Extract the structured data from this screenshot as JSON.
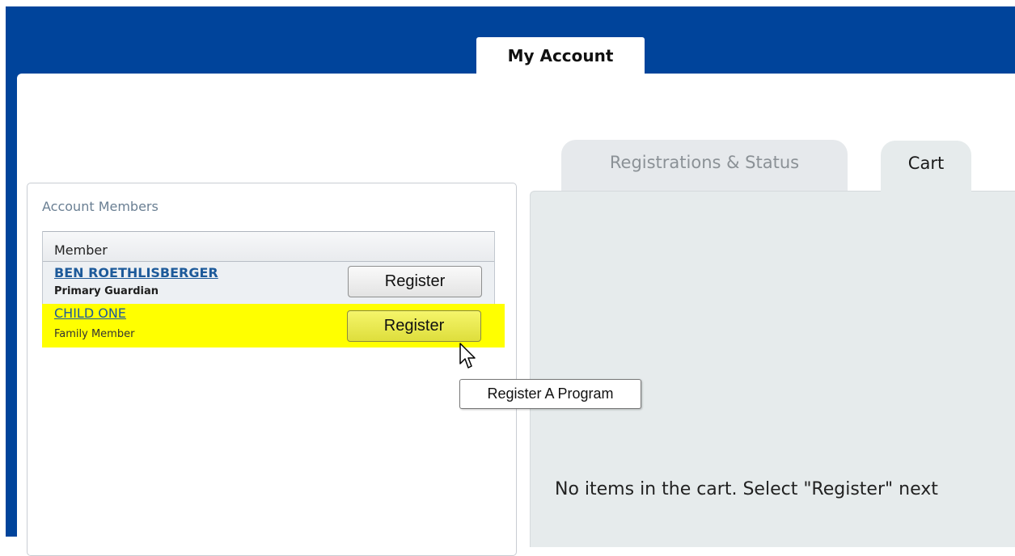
{
  "header": {
    "tab_my_account": "My Account"
  },
  "members": {
    "title": "Account Members",
    "column_header": "Member",
    "rows": [
      {
        "name": "BEN ROETHLISBERGER",
        "role": "Primary Guardian",
        "button": "Register"
      },
      {
        "name": "CHILD ONE",
        "role": "Family Member",
        "button": "Register",
        "highlight": "#ffff00"
      }
    ],
    "tooltip": "Register A Program"
  },
  "tabs": {
    "registrations": "Registrations & Status",
    "cart": "Cart"
  },
  "cart": {
    "message": "No items in the cart. Select \"Register\" next"
  },
  "colors": {
    "banner": "#00449b",
    "link": "#1d5a9a",
    "highlight": "#ffff00",
    "panel": "#e6ebec"
  }
}
